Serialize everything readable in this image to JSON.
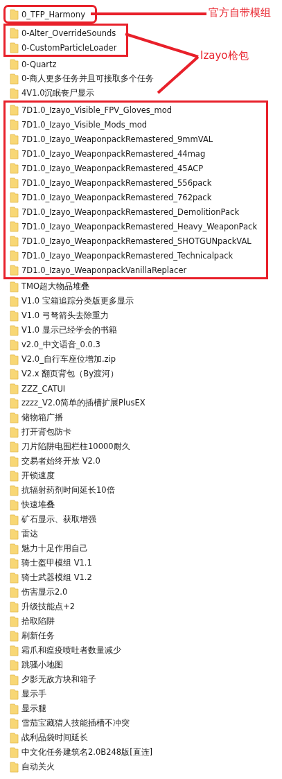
{
  "groups": [
    {
      "kind": "boxed",
      "items": [
        "0_TFP_Harmony"
      ]
    },
    {
      "kind": "boxed",
      "items": [
        "0-Alter_OverrideSounds",
        "0-CustomParticleLoader"
      ]
    },
    {
      "kind": "plain",
      "items": [
        "0-Quartz",
        "0-商人更多任务并且可接取多个任务",
        "4V1.0沉眠丧尸显示"
      ]
    },
    {
      "kind": "boxed",
      "items": [
        "7D1.0_Izayo_Visible_FPV_Gloves_mod",
        "7D1.0_Izayo_Visible_Mods_mod",
        "7D1.0_Izayo_WeaponpackRemastered_9mmVAL",
        "7D1.0_Izayo_WeaponpackRemastered_44mag",
        "7D1.0_Izayo_WeaponpackRemastered_45ACP",
        "7D1.0_Izayo_WeaponpackRemastered_556pack",
        "7D1.0_Izayo_WeaponpackRemastered_762pack",
        "7D1.0_Izayo_WeaponpackRemastered_DemolitionPack",
        "7D1.0_Izayo_WeaponpackRemastered_Heavy_WeaponPack",
        "7D1.0_Izayo_WeaponpackRemastered_SHOTGUNpackVAL",
        "7D1.0_Izayo_WeaponpackRemastered_Technicalpack",
        "7D1.0_Izayo_WeaponpackVanillaReplacer"
      ]
    },
    {
      "kind": "plain",
      "items": [
        "TMO超大物品堆叠",
        "V1.0 宝箱追踪分类版更多显示",
        "V1.0 弓弩箭头去除重力",
        "V1.0 显示已经学会的书籍",
        "v2.0_中文语音_0.0.3",
        "V2.0_自行车座位增加.zip",
        "V2.x 翻页背包（By渡河）",
        "ZZZ_CATUI",
        "zzzz_V2.0简单的插槽扩展PlusEX",
        "储物箱广播",
        "打开背包防卡",
        "刀片陷阱电围栏柱10000耐久",
        "交易者始终开放 V2.0",
        "开锁速度",
        "抗辐射药剂时间延长10倍",
        "快速堆叠",
        "矿石显示、获取增强",
        "雷达",
        "魅力十足作用自己",
        "骑士盔甲模组 V1.1",
        "骑士武器模组 V1.2",
        "伤害显示2.0",
        "升级技能点+2",
        "拾取陷阱",
        "刷新任务",
        "霜爪和瘟疫喷吐者数量减少",
        "跳骚小地图",
        "夕影无敌方块和箱子",
        "显示手",
        "显示腿",
        "雪茄宝藏猎人技能插槽不冲突",
        "战利品袋时间延长",
        "中文化任务建筑名2.0B248版[直连]",
        "自动关火"
      ]
    }
  ],
  "callouts": [
    {
      "label": "官方自带模组"
    },
    {
      "label": "Izayo枪包"
    }
  ]
}
